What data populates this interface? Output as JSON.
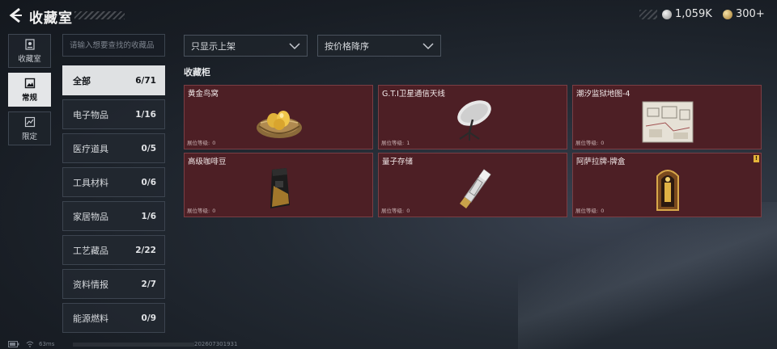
{
  "header": {
    "title": "收藏室",
    "currency": [
      {
        "icon": "silver-coin-icon",
        "value": "1,059K"
      },
      {
        "icon": "gold-coin-icon",
        "value": "300+"
      }
    ]
  },
  "nav": [
    {
      "label": "收藏室",
      "icon": "showcase-icon",
      "active": false
    },
    {
      "label": "常规",
      "icon": "picture-icon",
      "active": true
    },
    {
      "label": "限定",
      "icon": "limited-icon",
      "active": false
    }
  ],
  "search": {
    "placeholder": "请输入想要查找的收藏品"
  },
  "categories": [
    {
      "label": "全部",
      "count": "6/71"
    },
    {
      "label": "电子物品",
      "count": "1/16"
    },
    {
      "label": "医疗道具",
      "count": "0/5"
    },
    {
      "label": "工具材料",
      "count": "0/6"
    },
    {
      "label": "家居物品",
      "count": "1/6"
    },
    {
      "label": "工艺藏品",
      "count": "2/22"
    },
    {
      "label": "资料情报",
      "count": "2/7"
    },
    {
      "label": "能源燃料",
      "count": "0/9"
    }
  ],
  "filters": {
    "filter": "只显示上架",
    "sort": "按价格降序"
  },
  "section_title": "收藏柜",
  "items": [
    {
      "name": "黄金鸟窝",
      "level_label": "展位等级:",
      "level": "0",
      "icon": "golden-nest-icon"
    },
    {
      "name": "G.T.I卫星通信天线",
      "level_label": "展位等级:",
      "level": "1",
      "icon": "satellite-dish-icon"
    },
    {
      "name": "潮汐监狱地图-4",
      "level_label": "展位等级:",
      "level": "0",
      "icon": "prison-map-icon"
    },
    {
      "name": "高级咖啡豆",
      "level_label": "展位等级:",
      "level": "0",
      "icon": "coffee-bag-icon"
    },
    {
      "name": "量子存储",
      "level_label": "展位等级:",
      "level": "0",
      "icon": "usb-drive-icon"
    },
    {
      "name": "阿萨拉牌-牌盒",
      "level_label": "展位等级:",
      "level": "0",
      "icon": "card-box-icon",
      "badge": "!"
    }
  ],
  "colors": {
    "card_bg": "#4d1f25",
    "card_border": "#7a3e44",
    "active_bg": "#e4e6e8",
    "badge": "#e4b43a"
  },
  "footer": {
    "ping": "63ms",
    "version": "202607301931"
  }
}
